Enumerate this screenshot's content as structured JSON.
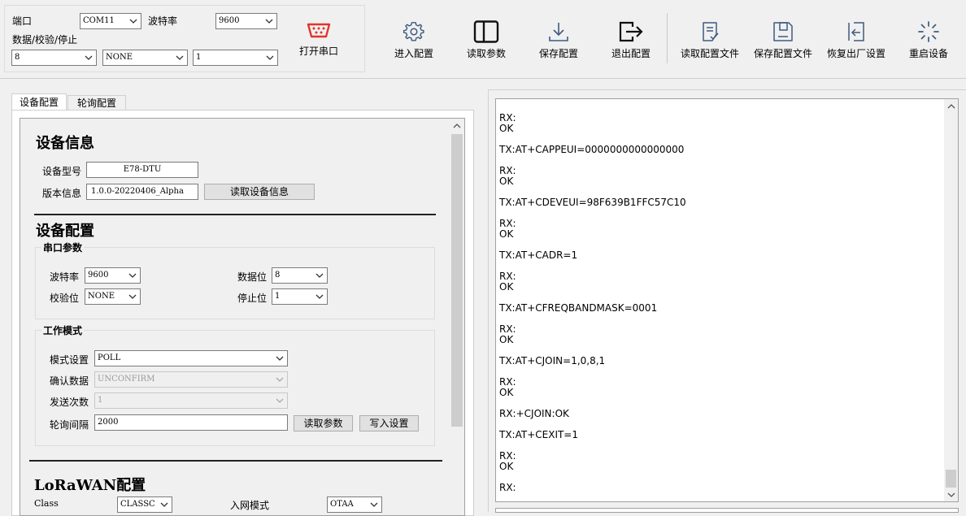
{
  "serial": {
    "port_label": "端口",
    "port_value": "COM11",
    "baud_label": "波特率",
    "baud_value": "9600",
    "dps_label": "数据/校验/停止",
    "data_bits": "8",
    "parity": "NONE",
    "stop_bits": "1",
    "open_label": "打开串口"
  },
  "toolbar": {
    "enter_config": "进入配置",
    "read_params": "读取参数",
    "save_config": "保存配置",
    "exit_config": "退出配置",
    "read_config_file": "读取配置文件",
    "save_config_file": "保存配置文件",
    "factory_reset": "恢复出厂设置",
    "restart_device": "重启设备"
  },
  "tabs": [
    "设备配置",
    "轮询配置"
  ],
  "device_info": {
    "title": "设备信息",
    "model_label": "设备型号",
    "model_value": "E78-DTU",
    "version_label": "版本信息",
    "version_value": "1.0.0-20220406_Alpha",
    "read_info_button": "读取设备信息"
  },
  "device_config": {
    "title": "设备配置",
    "serial_group": "串口参数",
    "baud_label": "波特率",
    "baud_value": "9600",
    "data_label": "数据位",
    "data_value": "8",
    "parity_label": "校验位",
    "parity_value": "NONE",
    "stop_label": "停止位",
    "stop_value": "1",
    "work_group": "工作模式",
    "mode_label": "模式设置",
    "mode_value": "POLL",
    "confirm_label": "确认数据",
    "confirm_value": "UNCONFIRM",
    "send_count_label": "发送次数",
    "send_count_value": "1",
    "interval_label": "轮询间隔",
    "interval_value": "2000",
    "read_params_button": "读取参数",
    "write_button": "写入设置"
  },
  "lorawan": {
    "title": "LoRaWAN配置",
    "class_label": "Class",
    "class_value": "CLASSC",
    "join_label": "入网模式",
    "join_value": "OTAA"
  },
  "log": {
    "lines": [
      "RX:",
      "OK",
      "",
      "TX:AT+CAPPEUI=0000000000000000",
      "",
      "RX:",
      "OK",
      "",
      "TX:AT+CDEVEUI=98F639B1FFC57C10",
      "",
      "RX:",
      "OK",
      "",
      "TX:AT+CADR=1",
      "",
      "RX:",
      "OK",
      "",
      "TX:AT+CFREQBANDMASK=0001",
      "",
      "RX:",
      "OK",
      "",
      "TX:AT+CJOIN=1,0,8,1",
      "",
      "RX:",
      "OK",
      "",
      "RX:+CJOIN:OK",
      "",
      "TX:AT+CEXIT=1",
      "",
      "RX:",
      "OK",
      "",
      "RX:"
    ]
  }
}
